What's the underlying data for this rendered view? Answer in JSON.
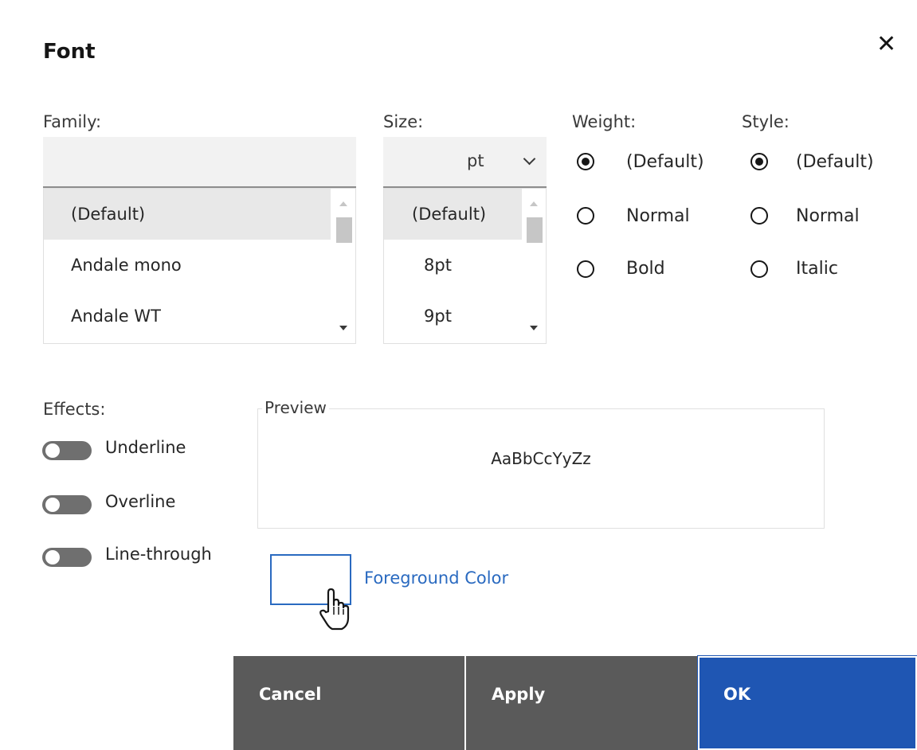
{
  "dialog": {
    "title": "Font",
    "close_icon": "close-icon"
  },
  "family": {
    "label": "Family:",
    "search_value": "",
    "items": [
      "(Default)",
      "Andale mono",
      "Andale WT"
    ],
    "selected_index": 0
  },
  "size": {
    "label": "Size:",
    "unit": "pt",
    "items": [
      "(Default)",
      "8pt",
      "9pt"
    ],
    "selected_index": 0
  },
  "weight": {
    "label": "Weight:",
    "options": [
      "(Default)",
      "Normal",
      "Bold"
    ],
    "selected_index": 0
  },
  "style": {
    "label": "Style:",
    "options": [
      "(Default)",
      "Normal",
      "Italic"
    ],
    "selected_index": 0
  },
  "effects": {
    "label": "Effects:",
    "toggles": [
      {
        "label": "Underline",
        "on": false
      },
      {
        "label": "Overline",
        "on": false
      },
      {
        "label": "Line-through",
        "on": false
      }
    ]
  },
  "preview": {
    "legend": "Preview",
    "text": "AaBbCcYyZz"
  },
  "foreground": {
    "link_text": "Foreground Color",
    "color": "#ffffff"
  },
  "buttons": {
    "cancel": "Cancel",
    "apply": "Apply",
    "ok": "OK"
  },
  "colors": {
    "primary": "#1f56b3",
    "secondary": "#5a5a5a",
    "link": "#2a6ac0"
  }
}
